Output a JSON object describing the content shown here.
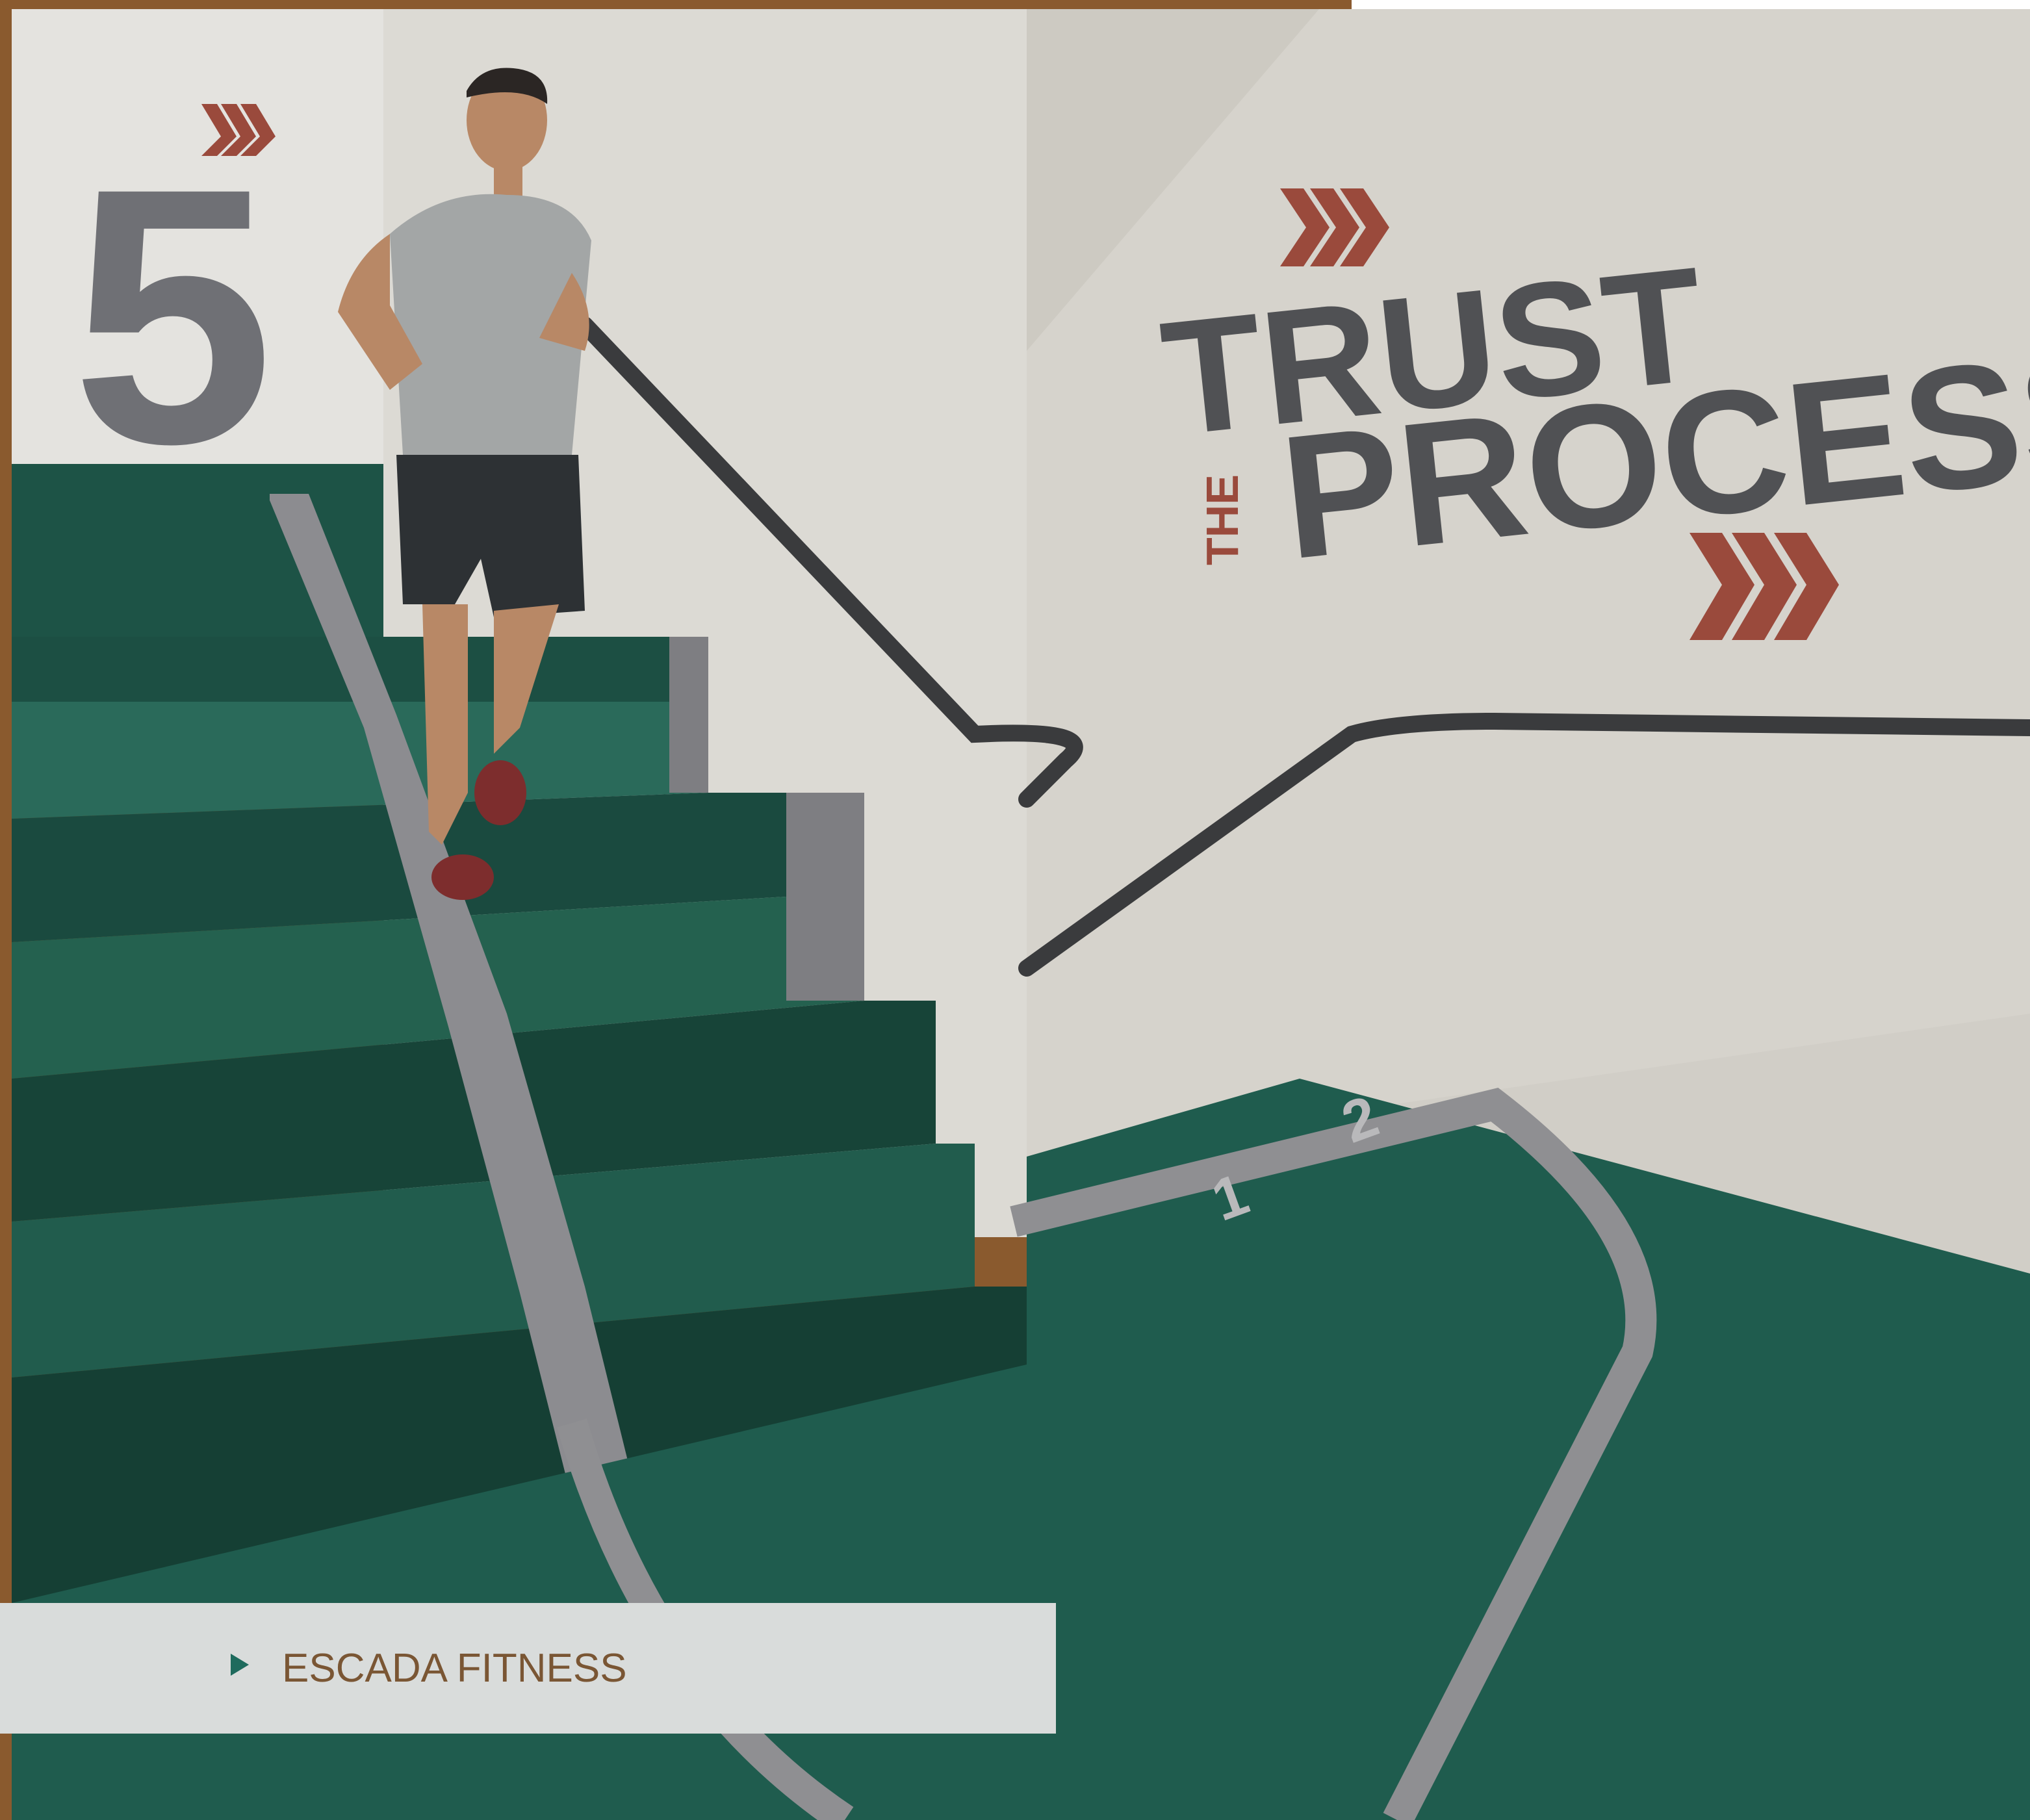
{
  "wall_sign": {
    "floor_number": "5",
    "line1": "TRUST",
    "line2_prefix": "THE",
    "line2": "PROCESS"
  },
  "track_lanes": [
    "1",
    "2"
  ],
  "caption": {
    "icon": "play-triangle-icon",
    "text": "ESCADA FITNESS"
  },
  "colors": {
    "frame_brown": "#8a5a2e",
    "track_green": "#1f5c4e",
    "lane_grey": "#8f8f92",
    "wall_concrete": "#d9d7d1",
    "arrow_red": "#9a4a3c",
    "sign_grey": "#505154",
    "caption_bar": "#d9dcdb",
    "caption_text": "#7a5634",
    "caption_marker": "#1e6b5d"
  }
}
